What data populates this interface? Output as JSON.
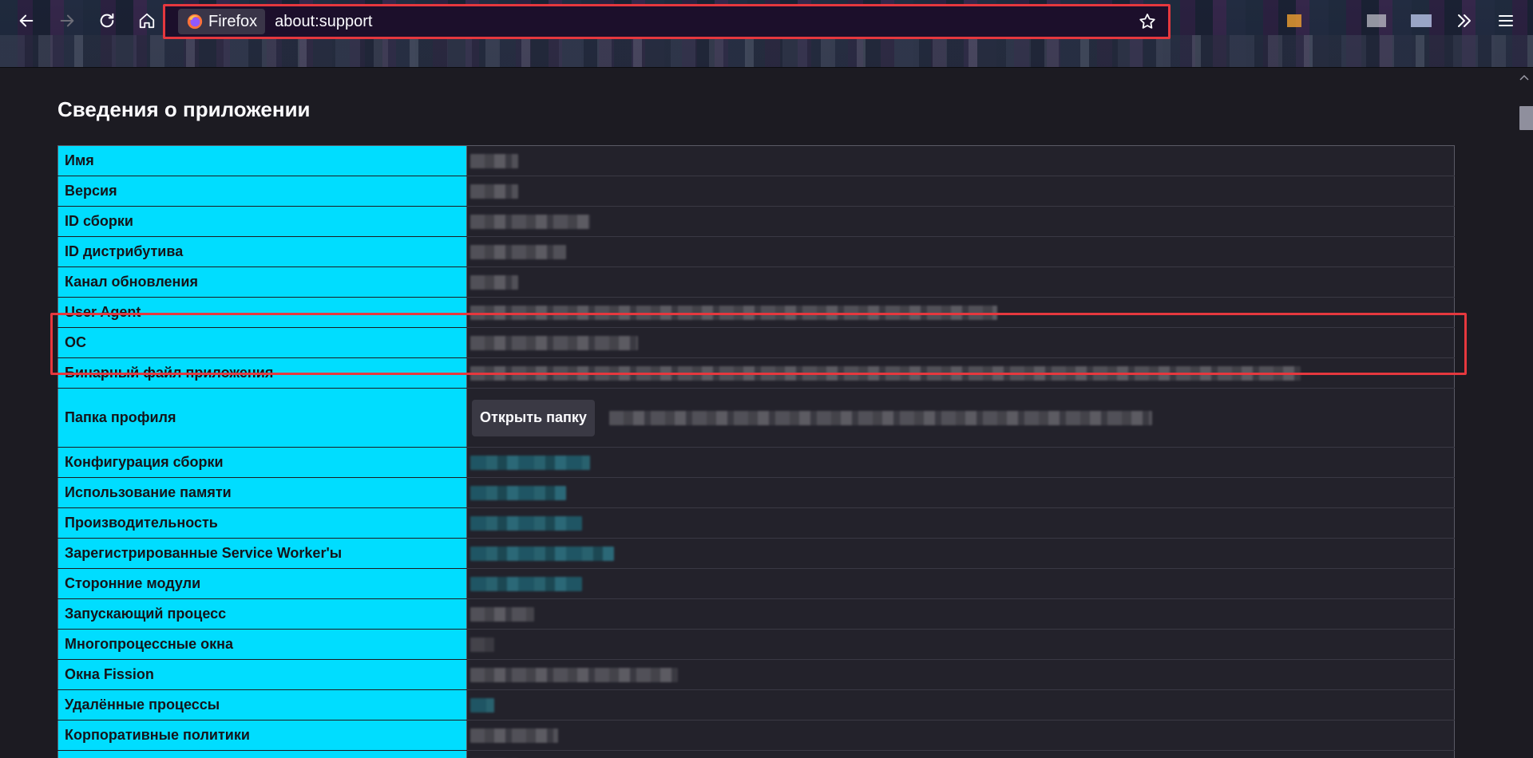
{
  "browser": {
    "identity_label": "Firefox",
    "url": "about:support",
    "accent_color": "#00ddff",
    "highlight_color": "#e5383e"
  },
  "page": {
    "title": "Сведения о приложении",
    "open_folder_button": "Открыть папку"
  },
  "rows": [
    {
      "label": "Имя",
      "value_style": "gray",
      "value_width": 60
    },
    {
      "label": "Версия",
      "value_style": "gray",
      "value_width": 60
    },
    {
      "label": "ID сборки",
      "value_style": "gray",
      "value_width": 150
    },
    {
      "label": "ID дистрибутива",
      "value_style": "gray",
      "value_width": 120
    },
    {
      "label": "Канал обновления",
      "value_style": "gray",
      "value_width": 60
    },
    {
      "label": "User Agent",
      "value_style": "gray",
      "value_width": 660
    },
    {
      "label": "ОС",
      "value_style": "gray",
      "value_width": 210
    },
    {
      "label": "Бинарный файл приложения",
      "value_style": "gray",
      "value_width": 1040
    },
    {
      "label": "Папка профиля",
      "value_style": "profile",
      "value_width": 680
    },
    {
      "label": "Конфигурация сборки",
      "value_style": "teal",
      "value_width": 150
    },
    {
      "label": "Использование памяти",
      "value_style": "teal",
      "value_width": 120
    },
    {
      "label": "Производительность",
      "value_style": "teal",
      "value_width": 140
    },
    {
      "label": "Зарегистрированные Service Worker'ы",
      "value_style": "teal",
      "value_width": 180
    },
    {
      "label": "Сторонние модули",
      "value_style": "teal",
      "value_width": 140
    },
    {
      "label": "Запускающий процесс",
      "value_style": "gray",
      "value_width": 80
    },
    {
      "label": "Многопроцессные окна",
      "value_style": "dim",
      "value_width": 30
    },
    {
      "label": "Окна Fission",
      "value_style": "gray",
      "value_width": 260
    },
    {
      "label": "Удалённые процессы",
      "value_style": "teal",
      "value_width": 30
    },
    {
      "label": "Корпоративные политики",
      "value_style": "gray",
      "value_width": 110
    },
    {
      "label": "",
      "value_style": "dim",
      "value_width": 60
    }
  ]
}
